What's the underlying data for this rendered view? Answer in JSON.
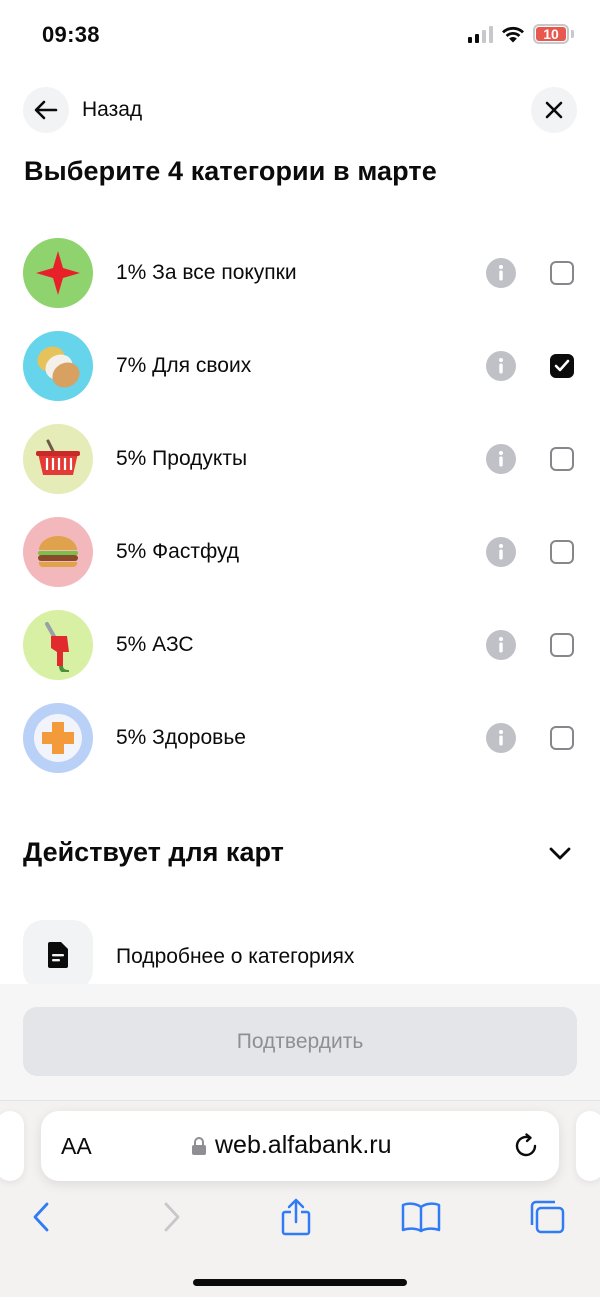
{
  "status_bar": {
    "time": "09:38",
    "battery": "10"
  },
  "header": {
    "back_label": "Назад",
    "title": "Выберите 4 категории в марте"
  },
  "categories": [
    {
      "label": "1% За все покупки",
      "checked": false,
      "icon": "star-icon",
      "bg": "#8fd36e"
    },
    {
      "label": "7% Для своих",
      "checked": true,
      "icon": "coins-icon",
      "bg": "#66d4ea"
    },
    {
      "label": "5% Продукты",
      "checked": false,
      "icon": "basket-icon",
      "bg": "#e5ecb8"
    },
    {
      "label": "5% Фастфуд",
      "checked": false,
      "icon": "burger-icon",
      "bg": "#f2b8bb"
    },
    {
      "label": "5% АЗС",
      "checked": false,
      "icon": "fuel-nozzle-icon",
      "bg": "#d7f0a4"
    },
    {
      "label": "5% Здоровье",
      "checked": false,
      "icon": "health-cross-icon",
      "bg": "#b9d0f7"
    }
  ],
  "cards_section": {
    "title": "Действует для карт"
  },
  "details": {
    "label": "Подробнее о категориях"
  },
  "confirm": {
    "label": "Подтвердить"
  },
  "browser": {
    "text_size_label": "AA",
    "url": "web.alfabank.ru"
  },
  "colors": {
    "accent_disabled": "#e4e5e8",
    "checkbox_checked": "#0b0b0c",
    "info_icon": "#bfc1c6"
  }
}
